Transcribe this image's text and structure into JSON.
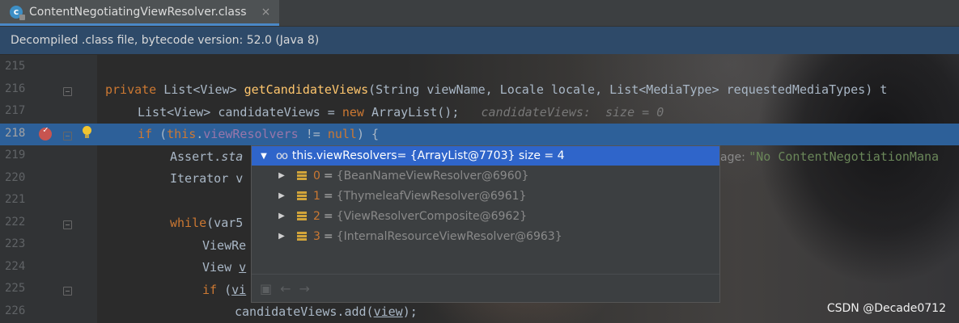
{
  "tab": {
    "title": "ContentNegotiatingViewResolver.class",
    "close": "×",
    "icon_letter": "c"
  },
  "infobar": {
    "text": "Decompiled .class file, bytecode version: 52.0 (Java 8)"
  },
  "line_numbers": [
    "215",
    "216",
    "217",
    "218",
    "219",
    "220",
    "221",
    "222",
    "223",
    "224",
    "225",
    "226"
  ],
  "code": {
    "l216": {
      "kw": "private",
      "t1": " List<View> ",
      "fn": "getCandidateViews",
      "t2": "(String viewName, Locale locale, List<MediaType> requestedMediaTypes) t"
    },
    "l217": {
      "t1": "List<View> candidateViews = ",
      "kw": "new",
      "t2": " ArrayList();",
      "hint": "candidateViews:  size = 0"
    },
    "l218": {
      "kw1": "if",
      "t1": " (",
      "kw2": "this",
      "dot": ".",
      "field": "viewResolvers",
      "t2": " != ",
      "kw3": "null",
      "t3": ") {"
    },
    "l219": {
      "t1": "Assert.",
      "italic": "sta",
      "hint": "age: ",
      "str": "\"No ContentNegotiationMana"
    },
    "l220": {
      "t1": "Iterator v"
    },
    "l222": {
      "kw": "while",
      "t1": "(var5"
    },
    "l223": {
      "t1": "ViewRe"
    },
    "l224": {
      "t1": "View ",
      "ul": "v"
    },
    "l225": {
      "kw": "if",
      "t1": " (",
      "ul": "vi"
    },
    "l226": {
      "t1": "candidateViews.add(",
      "ul": "view",
      "t2": ");"
    }
  },
  "popup": {
    "header": {
      "expression": "this.viewResolvers",
      "value": " = {ArrayList@7703}  size = 4"
    },
    "items": [
      {
        "index": "0",
        "value": "{BeanNameViewResolver@6960}"
      },
      {
        "index": "1",
        "value": "{ThymeleafViewResolver@6961}"
      },
      {
        "index": "2",
        "value": "{ViewResolverComposite@6962}"
      },
      {
        "index": "3",
        "value": "{InternalResourceViewResolver@6963}"
      }
    ],
    "footer_icons": [
      "pin-icon",
      "back-arrow-icon",
      "forward-arrow-icon"
    ]
  },
  "watermark": "CSDN @Decade0712",
  "colors": {
    "accent": "#2f65ca",
    "keyword": "#cc7832",
    "method": "#ffc66d",
    "field": "#9876aa",
    "string": "#6a8759",
    "breakpoint": "#c75450"
  }
}
